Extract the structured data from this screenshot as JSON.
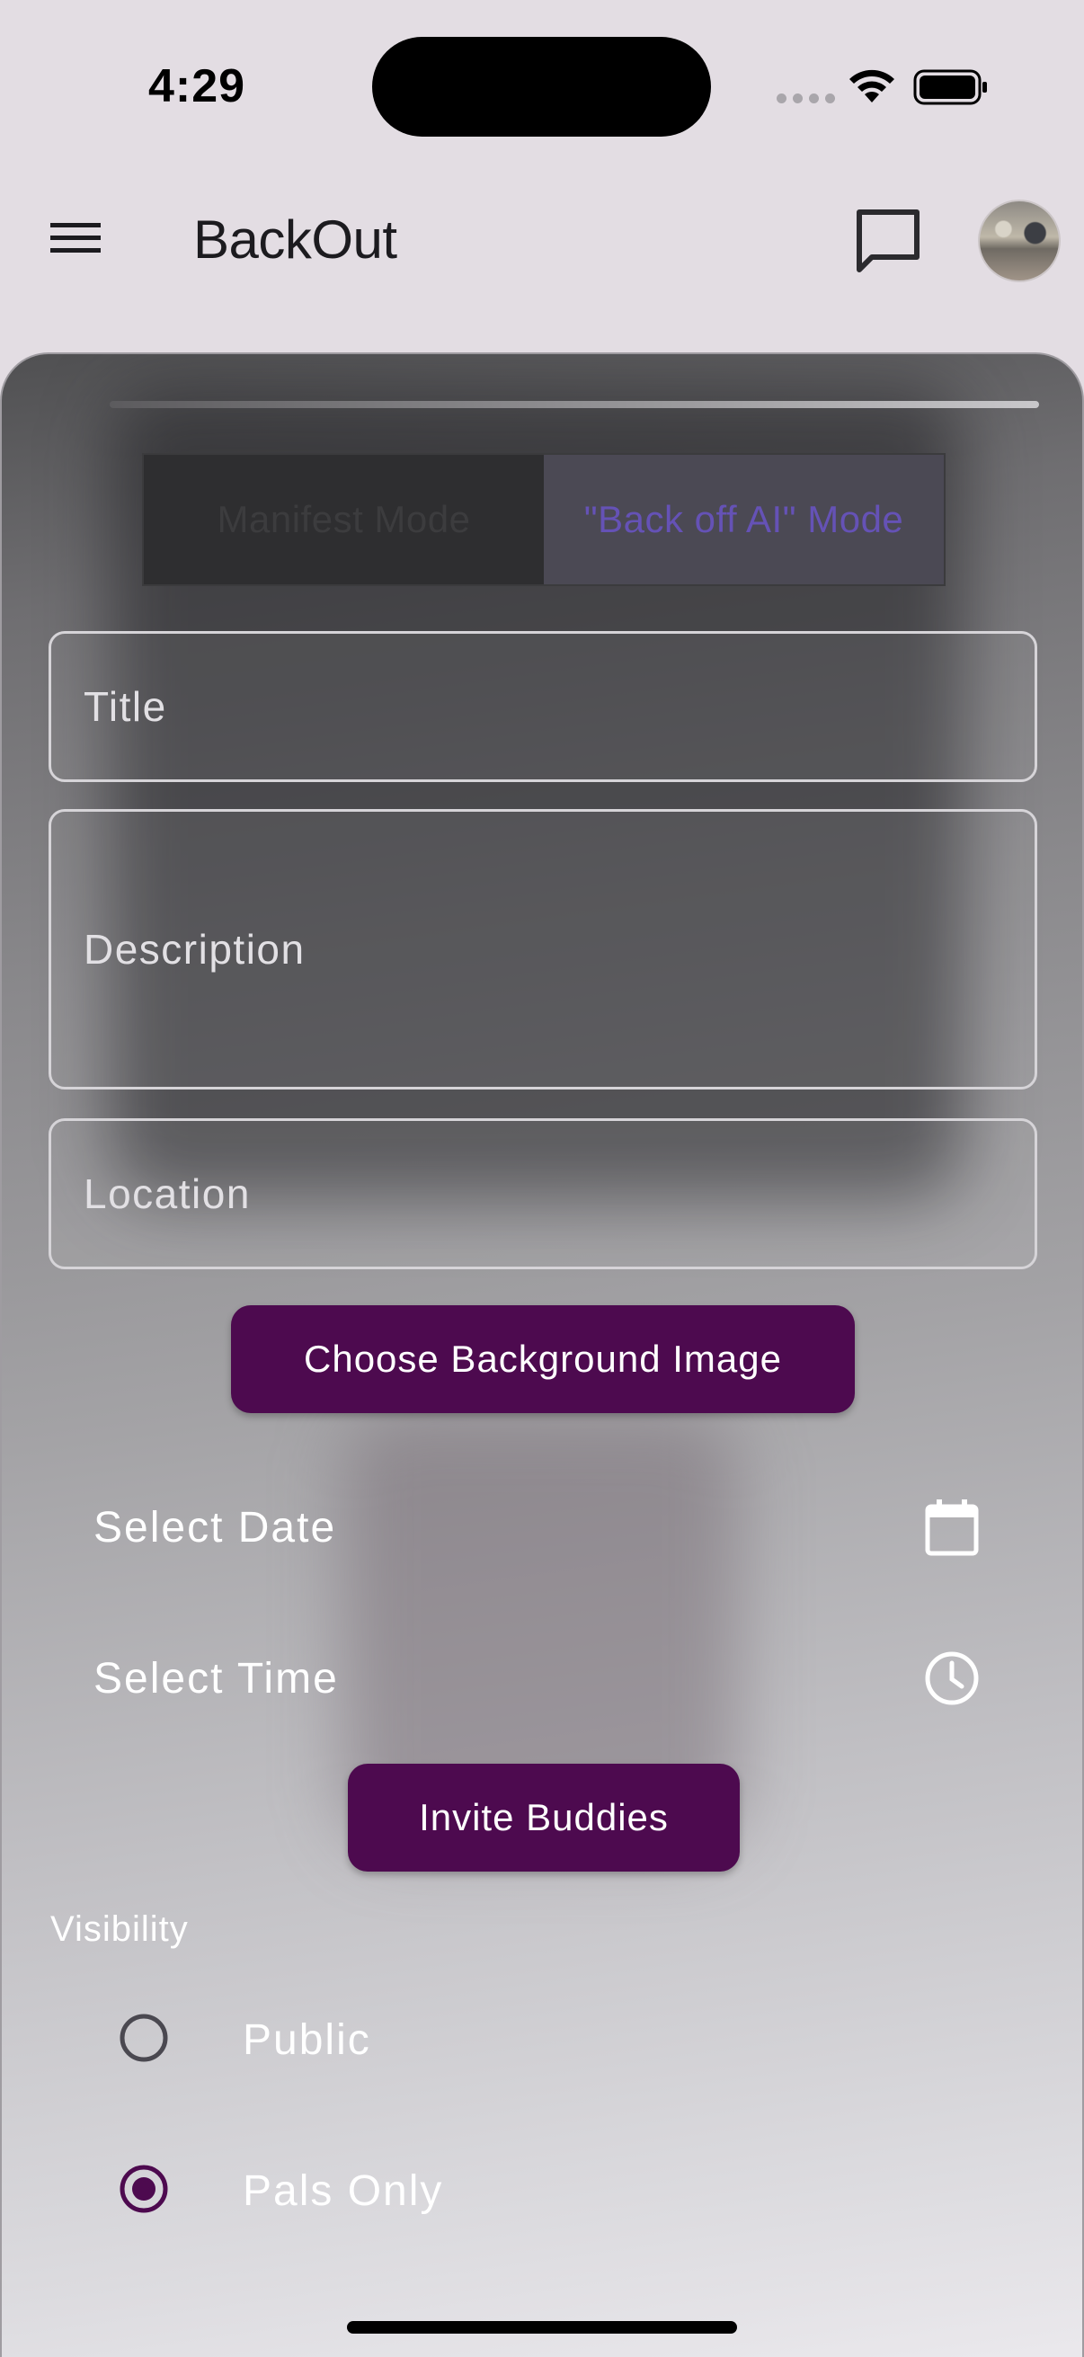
{
  "status_bar": {
    "time": "4:29"
  },
  "app_bar": {
    "title": "BackOut",
    "menu_icon": "menu-icon",
    "chat_icon": "chat-bubble-icon"
  },
  "form": {
    "modes": [
      {
        "label": "Manifest Mode",
        "selected": false
      },
      {
        "label": "\"Back off AI\" Mode",
        "selected": true
      }
    ],
    "title_placeholder": "Title",
    "description_placeholder": "Description",
    "location_placeholder": "Location",
    "choose_bg_label": "Choose Background Image",
    "select_date_label": "Select Date",
    "select_time_label": "Select Time",
    "invite_label": "Invite Buddies",
    "visibility_label": "Visibility",
    "visibility_options": [
      {
        "label": "Public",
        "selected": false
      },
      {
        "label": "Pals Only",
        "selected": true
      }
    ]
  },
  "colors": {
    "button": "#4d0a4f",
    "active_mode_text": "#6552b6",
    "radio_selected": "#4d0a4f"
  }
}
